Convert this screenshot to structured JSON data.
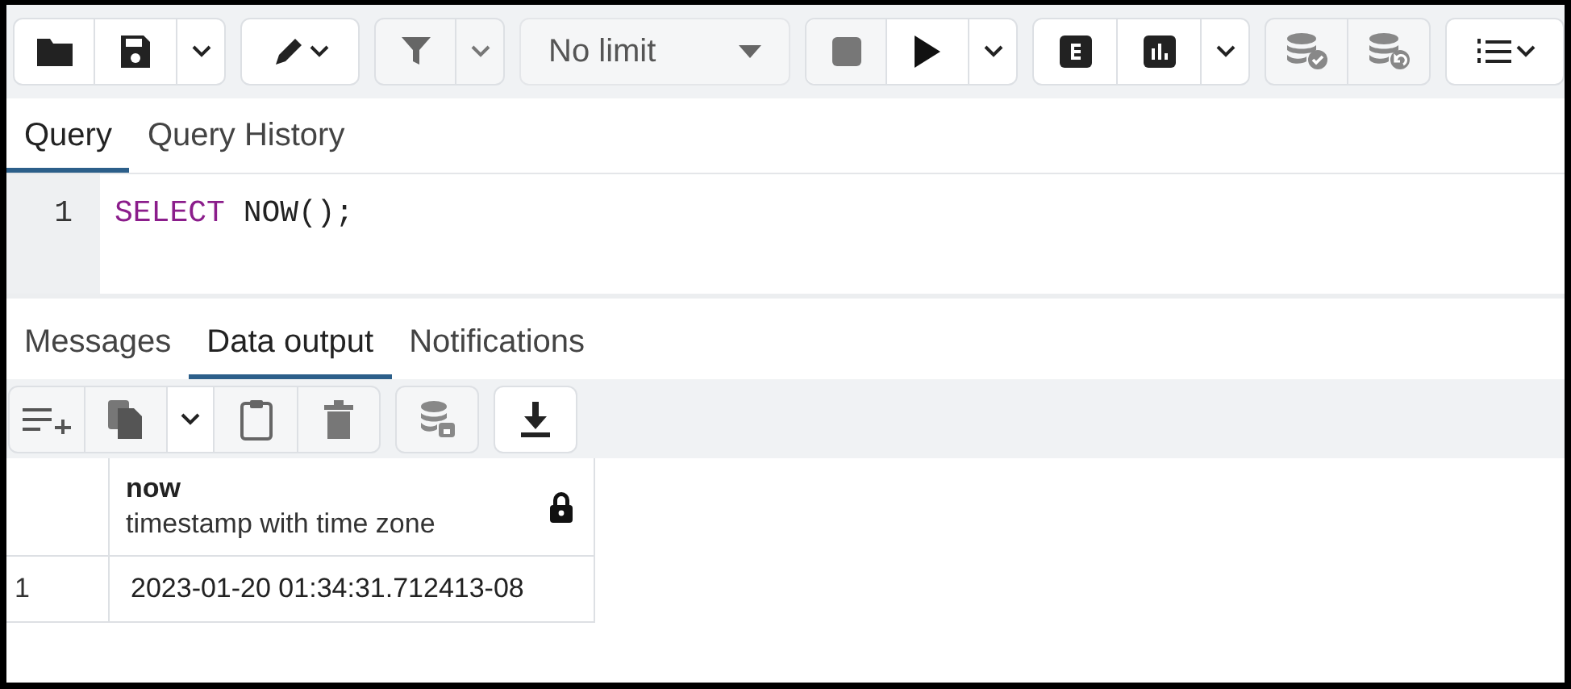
{
  "toolbar": {
    "row_limit": "No limit"
  },
  "query_tabs": [
    {
      "label": "Query",
      "selected": true
    },
    {
      "label": "Query History",
      "selected": false
    }
  ],
  "editor": {
    "lines": [
      {
        "number": "1",
        "tokens": [
          {
            "text": "SELECT",
            "kind": "keyword"
          },
          {
            "text": "NOW();",
            "kind": "plain"
          }
        ]
      }
    ]
  },
  "output_tabs": [
    {
      "label": "Messages",
      "selected": false
    },
    {
      "label": "Data output",
      "selected": true
    },
    {
      "label": "Notifications",
      "selected": false
    }
  ],
  "grid": {
    "columns": [
      {
        "name": "now",
        "type": "timestamp with time zone",
        "read_only": true
      }
    ],
    "rows": [
      {
        "number": "1",
        "cells": [
          "2023-01-20 01:34:31.712413-08"
        ]
      }
    ]
  }
}
